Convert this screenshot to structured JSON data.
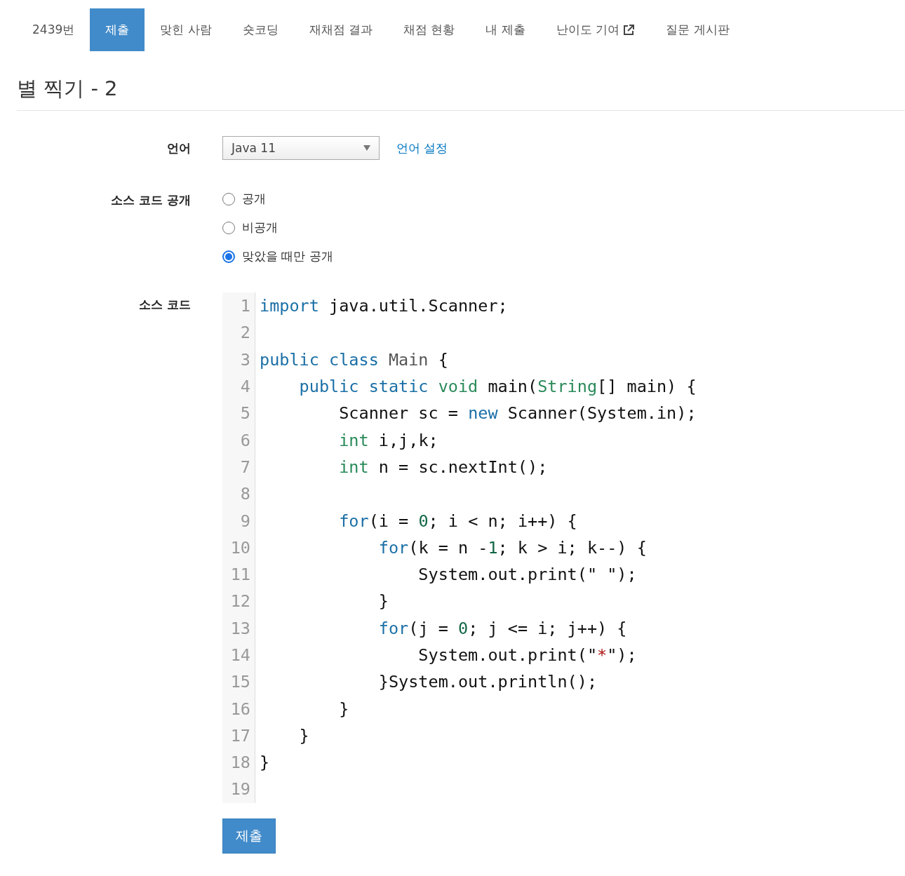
{
  "tabs": [
    {
      "label": "2439번",
      "selected": false,
      "external": false
    },
    {
      "label": "제출",
      "selected": true,
      "external": false
    },
    {
      "label": "맞힌 사람",
      "selected": false,
      "external": false
    },
    {
      "label": "숏코딩",
      "selected": false,
      "external": false
    },
    {
      "label": "재채점 결과",
      "selected": false,
      "external": false
    },
    {
      "label": "채점 현황",
      "selected": false,
      "external": false
    },
    {
      "label": "내 제출",
      "selected": false,
      "external": false
    },
    {
      "label": "난이도 기여",
      "selected": false,
      "external": true
    },
    {
      "label": "질문 게시판",
      "selected": false,
      "external": false
    }
  ],
  "title": "별 찍기 - 2",
  "language": {
    "label": "언어",
    "value": "Java 11",
    "link": "언어 설정"
  },
  "visibility": {
    "label": "소스 코드 공개",
    "options": [
      {
        "label": "공개",
        "selected": false
      },
      {
        "label": "비공개",
        "selected": false
      },
      {
        "label": "맞았을 때만 공개",
        "selected": true
      }
    ]
  },
  "source": {
    "label": "소스 코드",
    "lines": [
      {
        "number": "1",
        "tokens": [
          {
            "kind": "kw",
            "text": "import"
          },
          {
            "kind": "plain",
            "text": " java.util.Scanner;"
          }
        ]
      },
      {
        "number": "2"
      },
      {
        "number": "3",
        "tokens": [
          {
            "kind": "kw",
            "text": "public class"
          },
          {
            "kind": "def",
            "text": " Main"
          },
          {
            "kind": "plain",
            "text": " {"
          }
        ]
      },
      {
        "number": "4",
        "tokens": [
          {
            "kind": "kw",
            "text": "    public static"
          },
          {
            "kind": "type",
            "text": " void"
          },
          {
            "kind": "plain",
            "text": " main("
          },
          {
            "kind": "type",
            "text": "String"
          },
          {
            "kind": "plain",
            "text": "[] main) {"
          }
        ]
      },
      {
        "number": "5",
        "tokens": [
          {
            "kind": "plain",
            "text": "        Scanner sc = "
          },
          {
            "kind": "kw",
            "text": "new"
          },
          {
            "kind": "plain",
            "text": " Scanner(System.in);"
          }
        ]
      },
      {
        "number": "6",
        "tokens": [
          {
            "kind": "type",
            "text": "        int"
          },
          {
            "kind": "plain",
            "text": " i,j,k;"
          }
        ]
      },
      {
        "number": "7",
        "tokens": [
          {
            "kind": "type",
            "text": "        int"
          },
          {
            "kind": "plain",
            "text": " n = sc.nextInt();"
          }
        ]
      },
      {
        "number": "8"
      },
      {
        "number": "9",
        "tokens": [
          {
            "kind": "kw",
            "text": "        for"
          },
          {
            "kind": "plain",
            "text": "(i = "
          },
          {
            "kind": "num",
            "text": "0"
          },
          {
            "kind": "plain",
            "text": "; i < n; i++) {"
          }
        ]
      },
      {
        "number": "10",
        "tokens": [
          {
            "kind": "kw",
            "text": "            for"
          },
          {
            "kind": "plain",
            "text": "(k = n -"
          },
          {
            "kind": "num",
            "text": "1"
          },
          {
            "kind": "plain",
            "text": "; k > i; k--) {"
          }
        ]
      },
      {
        "number": "11",
        "tokens": [
          {
            "kind": "plain",
            "text": "                System.out.print(\" \");"
          }
        ]
      },
      {
        "number": "12",
        "tokens": [
          {
            "kind": "plain",
            "text": "            }"
          }
        ]
      },
      {
        "number": "13",
        "tokens": [
          {
            "kind": "kw",
            "text": "            for"
          },
          {
            "kind": "plain",
            "text": "(j = "
          },
          {
            "kind": "num",
            "text": "0"
          },
          {
            "kind": "plain",
            "text": "; j <= i; j++) {"
          }
        ]
      },
      {
        "number": "14",
        "tokens": [
          {
            "kind": "plain",
            "text": "                System.out.print(\""
          },
          {
            "kind": "str",
            "text": "*"
          },
          {
            "kind": "plain",
            "text": "\");"
          }
        ]
      },
      {
        "number": "15",
        "tokens": [
          {
            "kind": "plain",
            "text": "            }System.out.println();"
          }
        ]
      },
      {
        "number": "16",
        "tokens": [
          {
            "kind": "plain",
            "text": "        }"
          }
        ]
      },
      {
        "number": "17",
        "tokens": [
          {
            "kind": "plain",
            "text": "    }"
          }
        ]
      },
      {
        "number": "18",
        "tokens": [
          {
            "kind": "plain",
            "text": "}"
          }
        ]
      },
      {
        "number": "19"
      }
    ]
  },
  "submit": "제출"
}
